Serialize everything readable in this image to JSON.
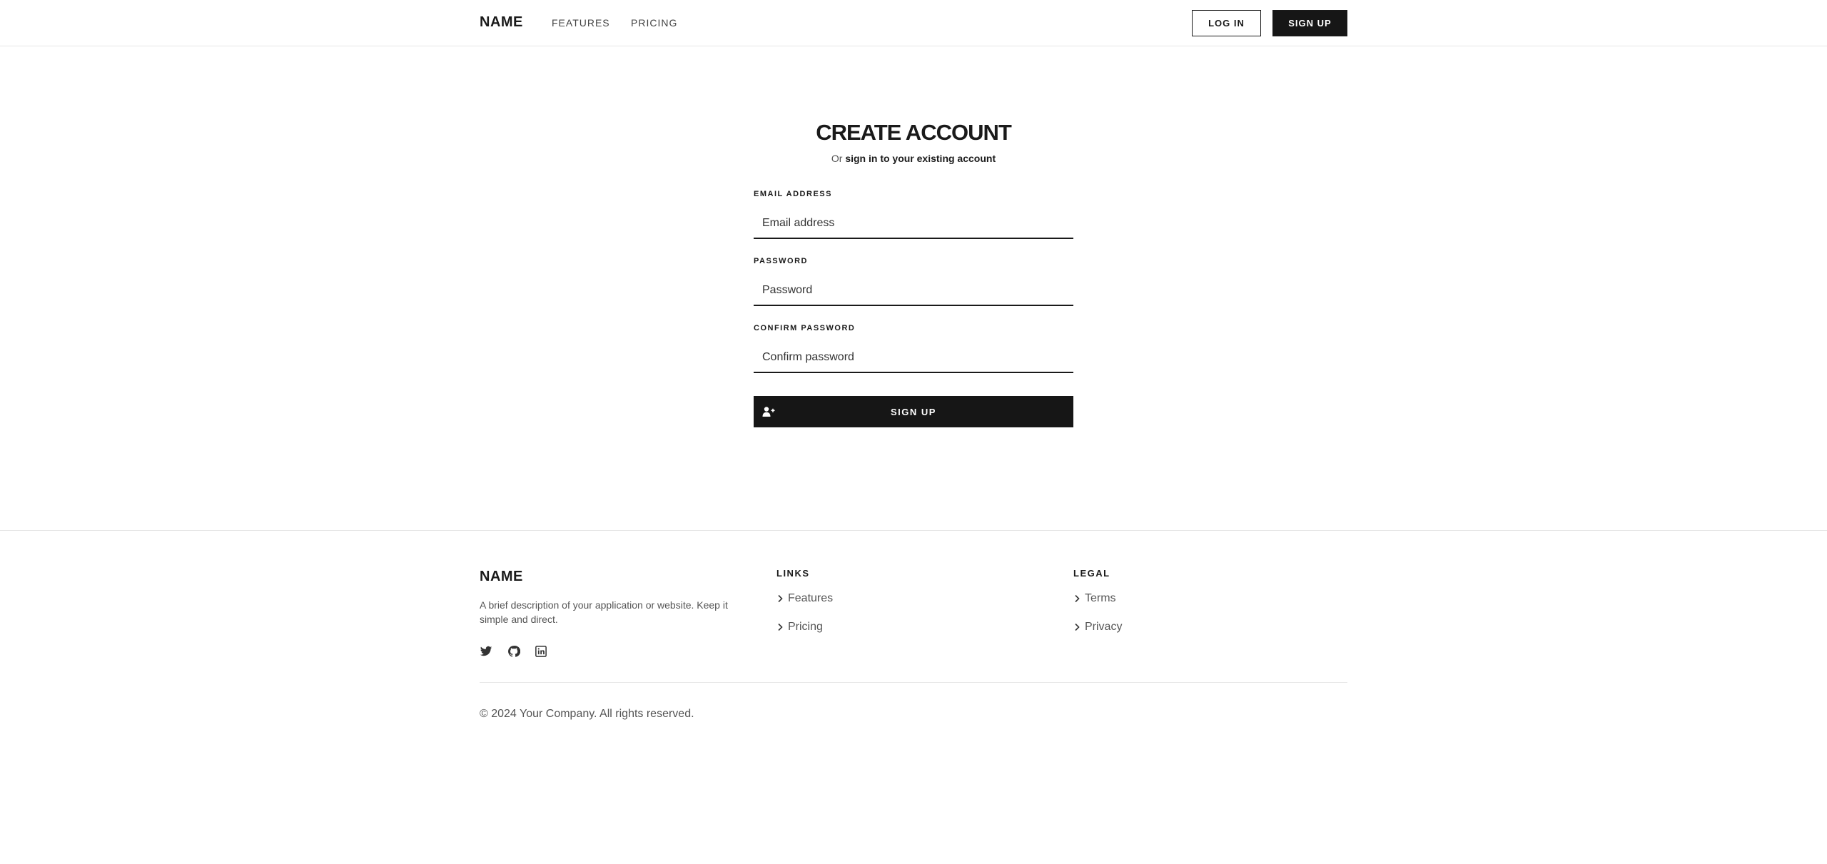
{
  "header": {
    "logo": "NAME",
    "nav": {
      "features": "FEATURES",
      "pricing": "PRICING"
    },
    "login_label": "LOG IN",
    "signup_label": "SIGN UP"
  },
  "form": {
    "title": "CREATE ACCOUNT",
    "subtitle_prefix": "Or",
    "subtitle_link": "sign in to your existing account",
    "email": {
      "label": "EMAIL ADDRESS",
      "placeholder": "Email address",
      "value": ""
    },
    "password": {
      "label": "PASSWORD",
      "placeholder": "Password",
      "value": ""
    },
    "confirm": {
      "label": "CONFIRM PASSWORD",
      "placeholder": "Confirm password",
      "value": ""
    },
    "submit_label": "SIGN UP",
    "submit_icon": "user-plus-icon"
  },
  "footer": {
    "logo": "NAME",
    "description": "A brief description of your application or website. Keep it simple and direct.",
    "social_icons": [
      "twitter-icon",
      "github-icon",
      "linkedin-icon"
    ],
    "links_heading": "LINKS",
    "links": [
      "Features",
      "Pricing"
    ],
    "legal_heading": "LEGAL",
    "legal": [
      "Terms",
      "Privacy"
    ],
    "copyright": "© 2024 Your Company. All rights reserved."
  },
  "colors": {
    "primary": "#161616",
    "border": "#e6e6e6",
    "muted_text": "#555555"
  }
}
